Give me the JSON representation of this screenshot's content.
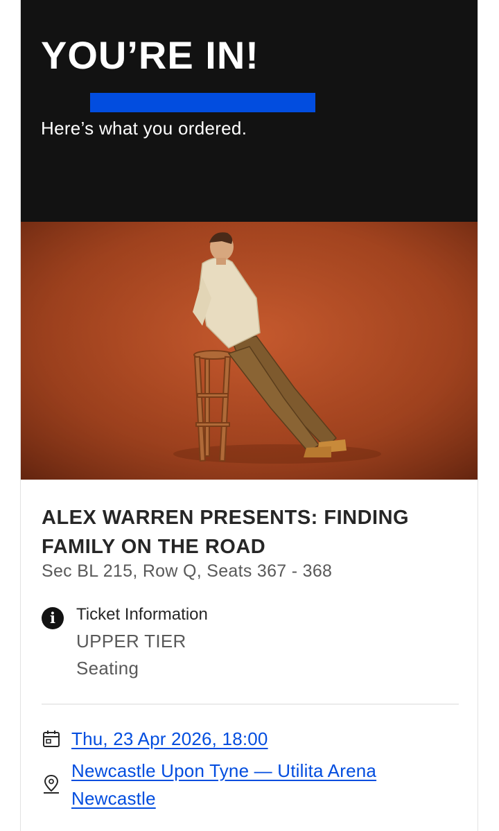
{
  "header": {
    "title": "YOU’RE IN!",
    "subtitle": "Here’s what you ordered."
  },
  "event": {
    "title": "ALEX WARREN PRESENTS: FINDING FAMILY ON THE ROAD",
    "seats": "Sec BL 215, Row Q, Seats 367 - 368",
    "ticket_info": {
      "heading": "Ticket Information",
      "tier": "UPPER TIER",
      "type": "Seating"
    },
    "date": "Thu, 23 Apr 2026, 18:00",
    "venue_line1": "Newcastle Upon Tyne — Utilita Arena",
    "venue_line2": "Newcastle"
  },
  "colors": {
    "hero_bg": "#121212",
    "accent": "#024ddf",
    "image_bg": "#a4441f"
  },
  "icons": {
    "info": "info-icon",
    "calendar": "calendar-icon",
    "location": "location-pin-icon"
  }
}
